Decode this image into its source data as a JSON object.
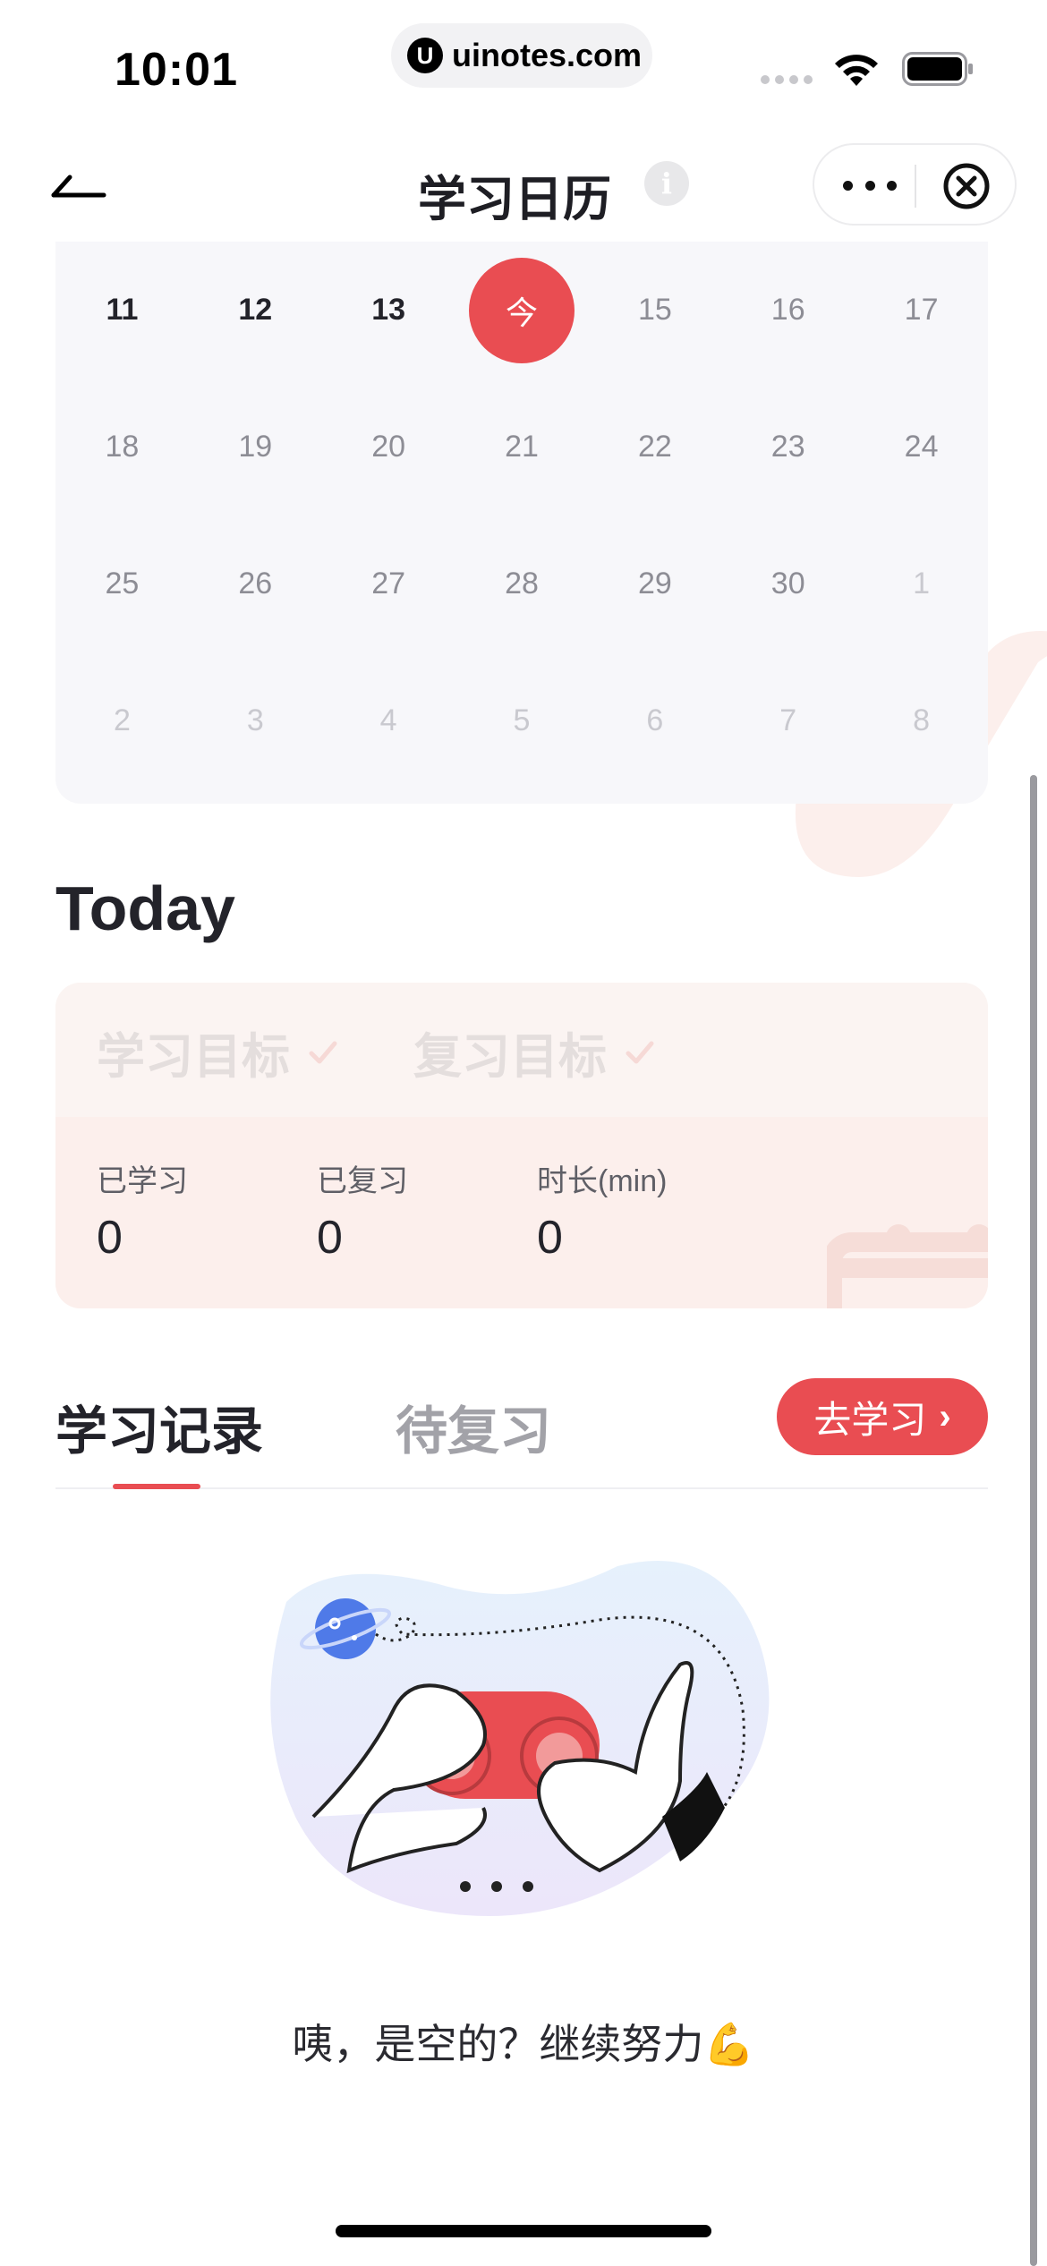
{
  "status_bar": {
    "time": "10:01",
    "url": "uinotes.com",
    "url_logo": "U",
    "icons": [
      "cellular-dots-icon",
      "wifi-icon",
      "battery-icon"
    ]
  },
  "nav": {
    "title": "学习日历",
    "info": "i",
    "icons": [
      "back-arrow-icon",
      "info-icon",
      "more-icon",
      "close-icon"
    ]
  },
  "calendar": {
    "rows": [
      [
        {
          "label": "11",
          "state": "past"
        },
        {
          "label": "12",
          "state": "past"
        },
        {
          "label": "13",
          "state": "past"
        },
        {
          "label": "今",
          "state": "today"
        },
        {
          "label": "15",
          "state": "future"
        },
        {
          "label": "16",
          "state": "future"
        },
        {
          "label": "17",
          "state": "future"
        }
      ],
      [
        {
          "label": "18",
          "state": "future"
        },
        {
          "label": "19",
          "state": "future"
        },
        {
          "label": "20",
          "state": "future"
        },
        {
          "label": "21",
          "state": "future"
        },
        {
          "label": "22",
          "state": "future"
        },
        {
          "label": "23",
          "state": "future"
        },
        {
          "label": "24",
          "state": "future"
        }
      ],
      [
        {
          "label": "25",
          "state": "future"
        },
        {
          "label": "26",
          "state": "future"
        },
        {
          "label": "27",
          "state": "future"
        },
        {
          "label": "28",
          "state": "future"
        },
        {
          "label": "29",
          "state": "future"
        },
        {
          "label": "30",
          "state": "future"
        },
        {
          "label": "1",
          "state": "other"
        }
      ],
      [
        {
          "label": "2",
          "state": "other"
        },
        {
          "label": "3",
          "state": "other"
        },
        {
          "label": "4",
          "state": "other"
        },
        {
          "label": "5",
          "state": "other"
        },
        {
          "label": "6",
          "state": "other"
        },
        {
          "label": "7",
          "state": "other"
        },
        {
          "label": "8",
          "state": "other"
        }
      ]
    ],
    "today_color": "#e94d52"
  },
  "today": {
    "heading": "Today",
    "goals": {
      "study_goal": "学习目标",
      "review_goal": "复习目标"
    },
    "stats": {
      "learned_label": "已学习",
      "learned_value": "0",
      "reviewed_label": "已复习",
      "reviewed_value": "0",
      "duration_label": "时长(min)",
      "duration_value": "0"
    }
  },
  "tabs": {
    "records": "学习记录",
    "pending_review": "待复习",
    "go_study": "去学习",
    "go_study_chevron": "›"
  },
  "empty_state": {
    "message": "咦，是空的？继续努力",
    "emoji_icon": "flexed-biceps-icon",
    "emoji": "💪"
  },
  "colors": {
    "accent": "#e94d52",
    "calendar_bg": "#f7f7fa",
    "today_card_bg": "#fcefec"
  }
}
